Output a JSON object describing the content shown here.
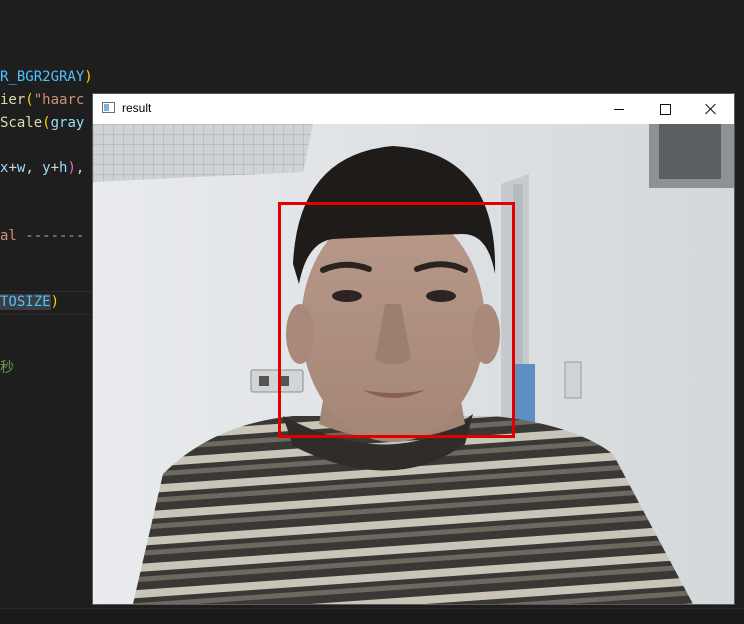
{
  "editor": {
    "lines": [
      {
        "segments": [
          {
            "text": "R_BGR2GRAY",
            "cls": "c-cyan"
          },
          {
            "text": ")",
            "cls": "c-paren"
          }
        ]
      },
      {
        "segments": [
          {
            "text": "ier",
            "cls": "c-fn"
          },
          {
            "text": "(",
            "cls": "c-paren"
          },
          {
            "text": "\"haarc",
            "cls": "c-str"
          }
        ]
      },
      {
        "segments": [
          {
            "text": "Scale",
            "cls": "c-fn"
          },
          {
            "text": "(",
            "cls": "c-paren"
          },
          {
            "text": "gray",
            "cls": "c-id"
          }
        ]
      },
      {
        "segments": []
      },
      {
        "segments": [
          {
            "text": "x",
            "cls": "c-id"
          },
          {
            "text": "+",
            "cls": "c-white"
          },
          {
            "text": "w",
            "cls": "c-id"
          },
          {
            "text": ", ",
            "cls": "c-white"
          },
          {
            "text": "y",
            "cls": "c-id"
          },
          {
            "text": "+",
            "cls": "c-white"
          },
          {
            "text": "h",
            "cls": "c-id"
          },
          {
            "text": ")",
            "cls": "c-pink"
          },
          {
            "text": ",",
            "cls": "c-white"
          }
        ]
      },
      {
        "segments": []
      },
      {
        "segments": []
      },
      {
        "segments": [
          {
            "text": "al -------",
            "cls": "c-orange"
          }
        ]
      },
      {
        "segments": []
      },
      {
        "segments": []
      },
      {
        "segments": [
          {
            "text": "TOSIZE",
            "cls": "c-cyan hl"
          },
          {
            "text": ")",
            "cls": "c-paren"
          }
        ]
      },
      {
        "segments": []
      },
      {
        "segments": []
      },
      {
        "segments": [
          {
            "text": "秒",
            "cls": "c-green"
          }
        ]
      }
    ]
  },
  "window": {
    "title": "result",
    "icons": {
      "app": "window-app-icon",
      "minimize": "minimize-icon",
      "maximize": "maximize-icon",
      "close": "close-icon"
    },
    "detection_box_color": "#e00000"
  }
}
